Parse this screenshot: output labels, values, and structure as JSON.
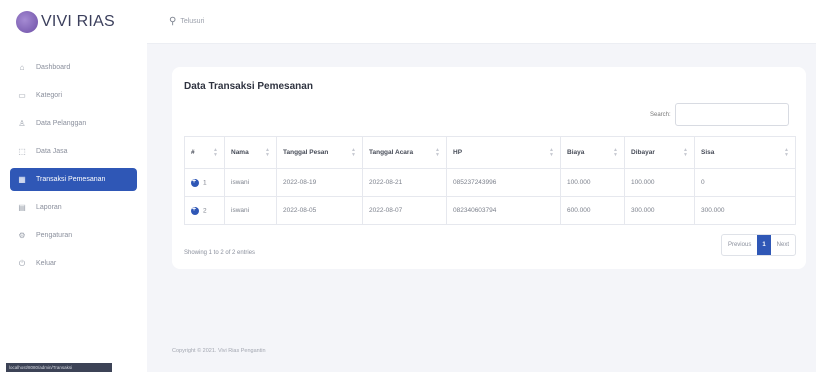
{
  "brand": {
    "name": "VIVI RIAS"
  },
  "topbar": {
    "search_label": "Telusuri"
  },
  "sidebar": {
    "items": [
      {
        "icon": "dashboard-icon",
        "glyph": "⌂",
        "label": "Dashboard"
      },
      {
        "icon": "category-icon",
        "glyph": "▭",
        "label": "Kategori"
      },
      {
        "icon": "user-icon",
        "glyph": "♙",
        "label": "Data Pelanggan"
      },
      {
        "icon": "service-icon",
        "glyph": "⬚",
        "label": "Data Jasa"
      },
      {
        "icon": "transaction-icon",
        "glyph": "▦",
        "label": "Transaksi Pemesanan"
      },
      {
        "icon": "report-icon",
        "glyph": "▤",
        "label": "Laporan"
      },
      {
        "icon": "settings-icon",
        "glyph": "⚙",
        "label": "Pengaturan"
      },
      {
        "icon": "logout-icon",
        "glyph": "⏻",
        "label": "Keluar"
      }
    ],
    "active_index": 4
  },
  "card": {
    "title": "Data Transaksi Pemesanan",
    "search_label": "Search:"
  },
  "table": {
    "headers": [
      "#",
      "Nama",
      "Tanggal Pesan",
      "Tanggal Acara",
      "HP",
      "Biaya",
      "Dibayar",
      "Sisa"
    ],
    "rows": [
      [
        "1",
        "iswani",
        "2022-08-19",
        "2022-08-21",
        "085237243996",
        "100.000",
        "100.000",
        "0"
      ],
      [
        "2",
        "iswani",
        "2022-08-05",
        "2022-08-07",
        "082340603794",
        "600.000",
        "300.000",
        "300.000"
      ]
    ]
  },
  "pagination": {
    "info": "Showing 1 to 2 of 2 entries",
    "previous": "Previous",
    "current": "1",
    "next": "Next"
  },
  "footer": {
    "copyright": "Copyright © 2021. Vivi Rias Pengantin"
  },
  "status_bar": {
    "text": "localhost/8080/admin/Transaksi"
  },
  "colors": {
    "accent": "#2f57b6",
    "background": "#f4f5f9"
  }
}
